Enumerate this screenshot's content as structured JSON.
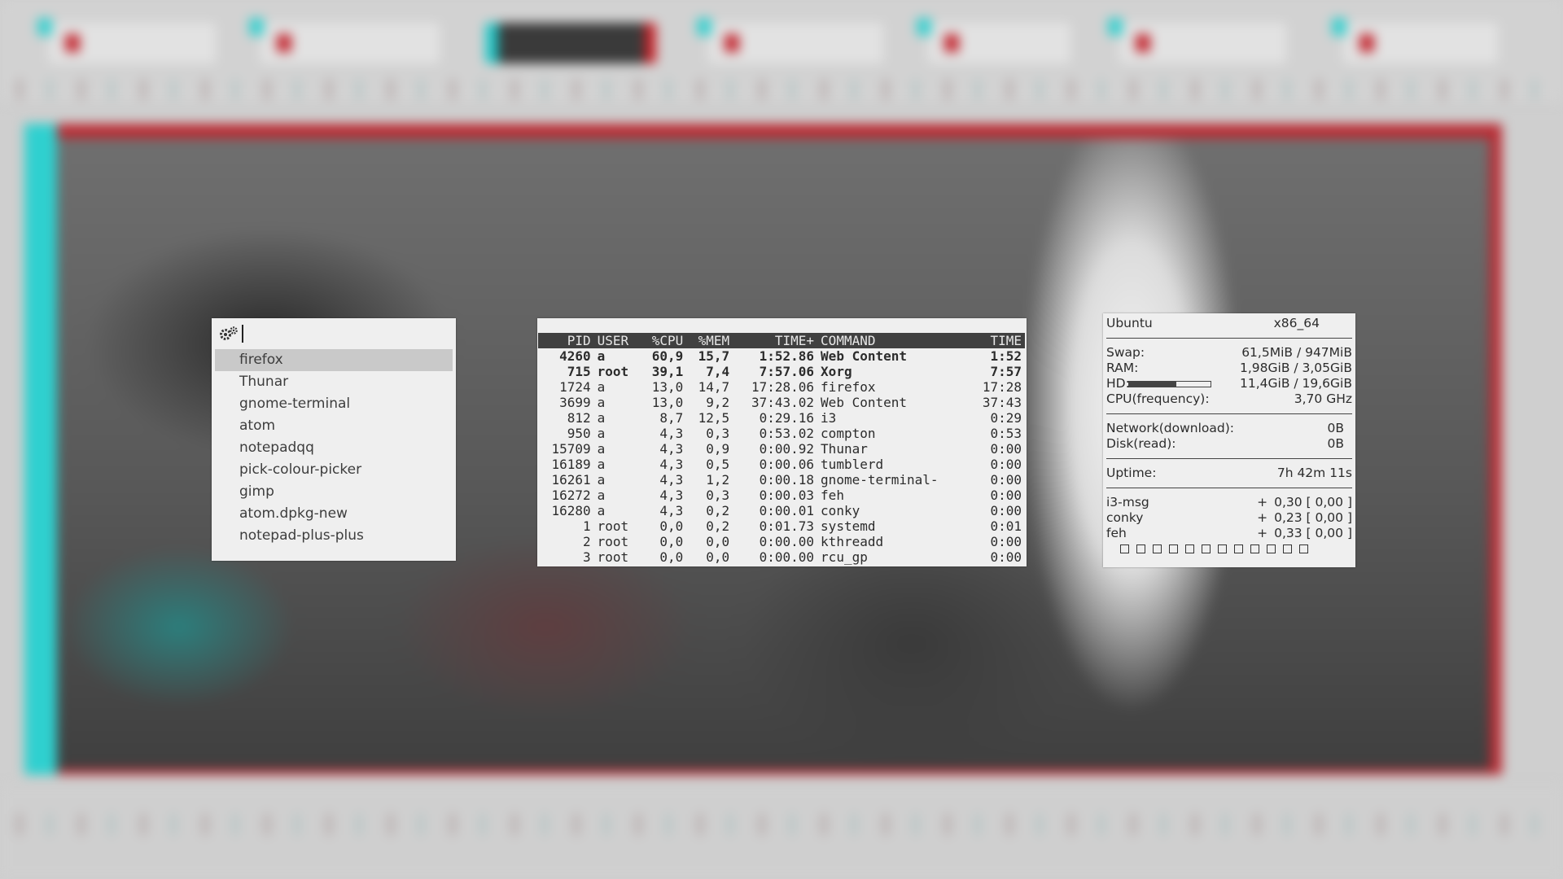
{
  "launcher": {
    "query": "",
    "icon": "gears-icon",
    "items": [
      {
        "label": "firefox",
        "selected": true
      },
      {
        "label": "Thunar",
        "selected": false
      },
      {
        "label": "gnome-terminal",
        "selected": false
      },
      {
        "label": "atom",
        "selected": false
      },
      {
        "label": "notepadqq",
        "selected": false
      },
      {
        "label": "pick-colour-picker",
        "selected": false
      },
      {
        "label": "gimp",
        "selected": false
      },
      {
        "label": "atom.dpkg-new",
        "selected": false
      },
      {
        "label": "notepad-plus-plus",
        "selected": false
      }
    ]
  },
  "processes": {
    "headers": [
      "PID",
      "USER",
      "%CPU",
      "%MEM",
      "TIME+",
      "COMMAND",
      "TIME"
    ],
    "rows": [
      [
        "4260",
        "a",
        "60,9",
        "15,7",
        "1:52.86",
        "Web Content",
        "1:52"
      ],
      [
        "715",
        "root",
        "39,1",
        "7,4",
        "7:57.06",
        "Xorg",
        "7:57"
      ],
      [
        "1724",
        "a",
        "13,0",
        "14,7",
        "17:28.06",
        "firefox",
        "17:28"
      ],
      [
        "3699",
        "a",
        "13,0",
        "9,2",
        "37:43.02",
        "Web Content",
        "37:43"
      ],
      [
        "812",
        "a",
        "8,7",
        "12,5",
        "0:29.16",
        "i3",
        "0:29"
      ],
      [
        "950",
        "a",
        "4,3",
        "0,3",
        "0:53.02",
        "compton",
        "0:53"
      ],
      [
        "15709",
        "a",
        "4,3",
        "0,9",
        "0:00.92",
        "Thunar",
        "0:00"
      ],
      [
        "16189",
        "a",
        "4,3",
        "0,5",
        "0:00.06",
        "tumblerd",
        "0:00"
      ],
      [
        "16261",
        "a",
        "4,3",
        "1,2",
        "0:00.18",
        "gnome-terminal-",
        "0:00"
      ],
      [
        "16272",
        "a",
        "4,3",
        "0,3",
        "0:00.03",
        "feh",
        "0:00"
      ],
      [
        "16280",
        "a",
        "4,3",
        "0,2",
        "0:00.01",
        "conky",
        "0:00"
      ],
      [
        "1",
        "root",
        "0,0",
        "0,2",
        "0:01.73",
        "systemd",
        "0:01"
      ],
      [
        "2",
        "root",
        "0,0",
        "0,0",
        "0:00.00",
        "kthreadd",
        "0:00"
      ],
      [
        "3",
        "root",
        "0,0",
        "0,0",
        "0:00.00",
        "rcu_gp",
        "0:00"
      ]
    ],
    "bold_rows": 2
  },
  "sysinfo": {
    "os": "Ubuntu",
    "arch": "x86_64",
    "swap_label": "Swap:",
    "swap": "61,5MiB / 947MiB",
    "ram_label": "RAM:",
    "ram": "1,98GiB / 3,05GiB",
    "hd_label": "HD:",
    "hd": "11,4GiB / 19,6GiB",
    "hd_fraction": 0.58,
    "cpu_label": "CPU(frequency):",
    "cpu": "3,70 GHz",
    "net_label": "Network(download):",
    "net": "0B",
    "disk_label": "Disk(read):",
    "disk": "0B",
    "uptime_label": "Uptime:",
    "uptime": "7h 42m 11s",
    "top_procs": [
      {
        "name": "i3-msg",
        "sign": "+",
        "value": "0,30 [  0,00 ]"
      },
      {
        "name": "conky",
        "sign": "+",
        "value": "0,23 [  0,00 ]"
      },
      {
        "name": "feh",
        "sign": "+",
        "value": "0,33 [  0,00 ]"
      }
    ],
    "workspace_boxes": 12
  },
  "colors": {
    "anaglyph_cyan": "#2fd0cf",
    "anaglyph_red": "#c42a33",
    "panel_bg": "#efefef",
    "header_bg": "#404040"
  }
}
